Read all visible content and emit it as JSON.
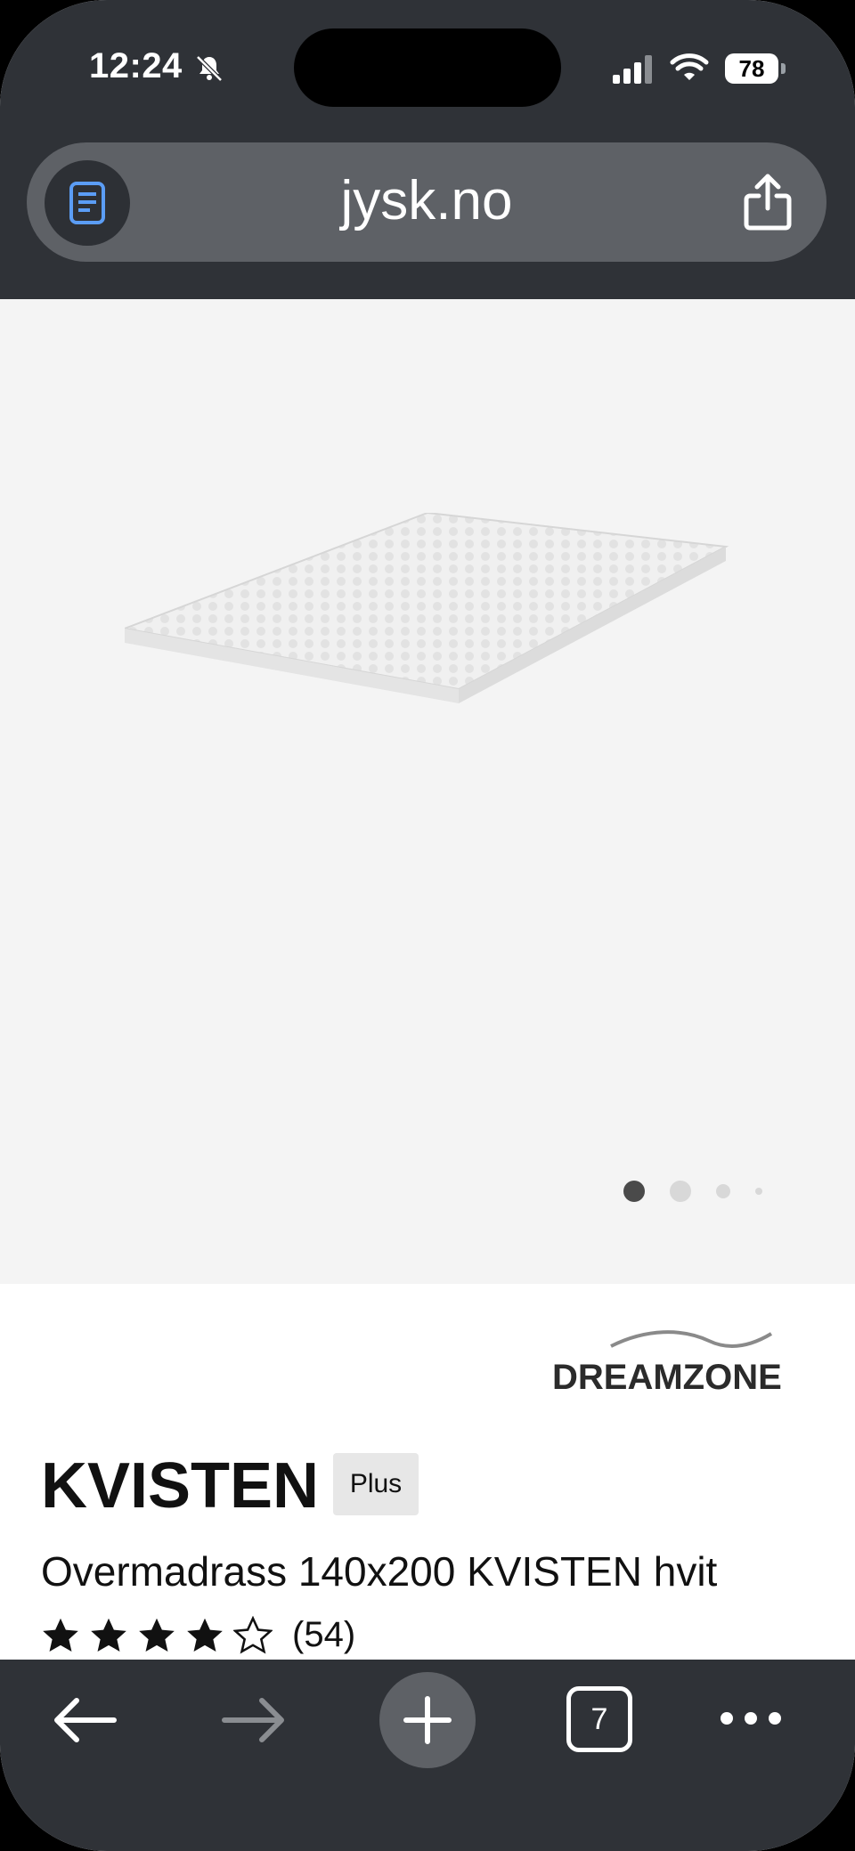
{
  "status_bar": {
    "time": "12:24",
    "battery": "78",
    "icons": [
      "bell-slash-icon",
      "signal-icon",
      "wifi-icon",
      "battery-icon"
    ]
  },
  "browser": {
    "url": "jysk.no",
    "icons": [
      "reader-icon",
      "share-icon"
    ]
  },
  "product": {
    "brand": "DREAMZONE",
    "name": "KVISTEN",
    "badge": "Plus",
    "description": "Overmadrass 140x200 KVISTEN hvit",
    "rating": 4,
    "rating_max": 5,
    "review_count": "(54)",
    "carousel_pages": 4,
    "carousel_active": 1
  },
  "toolbar": {
    "tabs_count": "7",
    "icons": [
      "back-arrow-icon",
      "forward-arrow-icon",
      "plus-icon",
      "tabs-icon",
      "more-icon"
    ]
  },
  "colors": {
    "chrome": "#2f3237",
    "url_bar": "#5e6166",
    "hero_bg": "#f4f4f4",
    "text": "#111111"
  }
}
